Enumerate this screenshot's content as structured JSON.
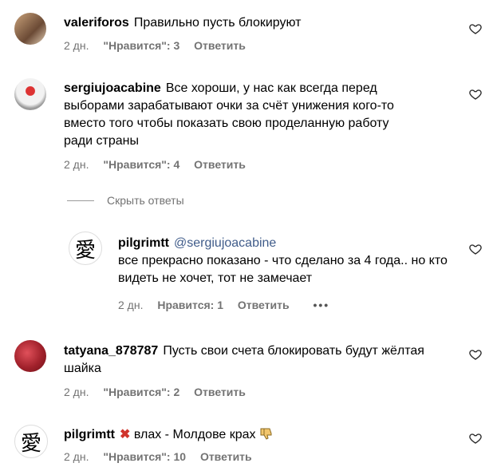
{
  "comments": [
    {
      "username": "valeriforos",
      "text": "Правильно пусть блокируют",
      "time": "2 дн.",
      "likes": "\"Нравится\": 3",
      "reply": "Ответить"
    },
    {
      "username": "sergiujoacabine",
      "text": "Все хороши, у нас как всегда перед выборами зарабатывают очки за счёт унижения кого-то вместо того чтобы показать свою проделанную работу ради страны",
      "time": "2 дн.",
      "likes": "\"Нравится\": 4",
      "reply": "Ответить"
    },
    {
      "username": "tatyana_878787",
      "text": "Пусть свои счета блокировать будут жёлтая шайка",
      "time": "2 дн.",
      "likes": "\"Нравится\": 2",
      "reply": "Ответить"
    },
    {
      "username": "pilgrimtt",
      "text": "влах - Молдове крах",
      "time": "2 дн.",
      "likes": "\"Нравится\": 10",
      "reply": "Ответить"
    }
  ],
  "hide_replies": "Скрыть ответы",
  "reply_comment": {
    "username": "pilgrimtt",
    "mention": "@sergiujoacabine",
    "text": "все прекрасно показано - что сделано за 4 года.. но кто видеть не хочет, тот не замечает",
    "time": "2 дн.",
    "likes": "Нравится: 1",
    "reply": "Ответить",
    "more": "•••"
  },
  "avatar_glyph": "愛",
  "colors": {
    "meta": "#737373",
    "mention": "#405c8a"
  }
}
